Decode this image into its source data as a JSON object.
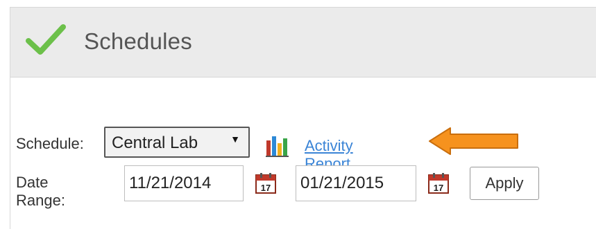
{
  "header": {
    "title": "Schedules",
    "icon": "check-icon",
    "accent": "#6cc04a"
  },
  "schedule": {
    "label": "Schedule:",
    "selected": "Central Lab",
    "caret": "▼"
  },
  "report": {
    "icon": "bar-chart-icon",
    "link_text": "Activity Report"
  },
  "annotation": {
    "arrow_color": "#f6921e"
  },
  "date_range": {
    "label": "Date Range:",
    "start": "11/21/2014",
    "end": "01/21/2015",
    "calendar_day": "17"
  },
  "actions": {
    "apply_label": "Apply"
  }
}
